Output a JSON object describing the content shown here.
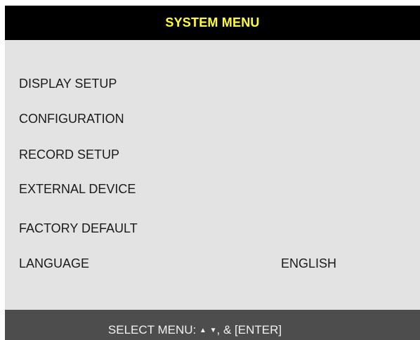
{
  "window": {
    "title": "SYSTEM MENU"
  },
  "menu": {
    "items": [
      {
        "label": "DISPLAY SETUP",
        "value": ""
      },
      {
        "label": "CONFIGURATION",
        "value": ""
      },
      {
        "label": "RECORD SETUP",
        "value": ""
      },
      {
        "label": "EXTERNAL DEVICE",
        "value": ""
      },
      {
        "label": "FACTORY DEFAULT",
        "value": ""
      },
      {
        "label": "LANGUAGE",
        "value": "ENGLISH"
      }
    ]
  },
  "footer": {
    "prefix": "SELECT MENU:",
    "up_arrow": "▲",
    "down_arrow": "▼",
    "suffix": ", & [ENTER]",
    "up_icon": "up-arrow-icon",
    "down_icon": "down-arrow-icon"
  },
  "colors": {
    "title_background": "#000000",
    "title_text": "#ffff33",
    "panel_background": "#e3e3e3",
    "footer_background": "#4d4d4d",
    "footer_text": "#f2f2f2"
  }
}
